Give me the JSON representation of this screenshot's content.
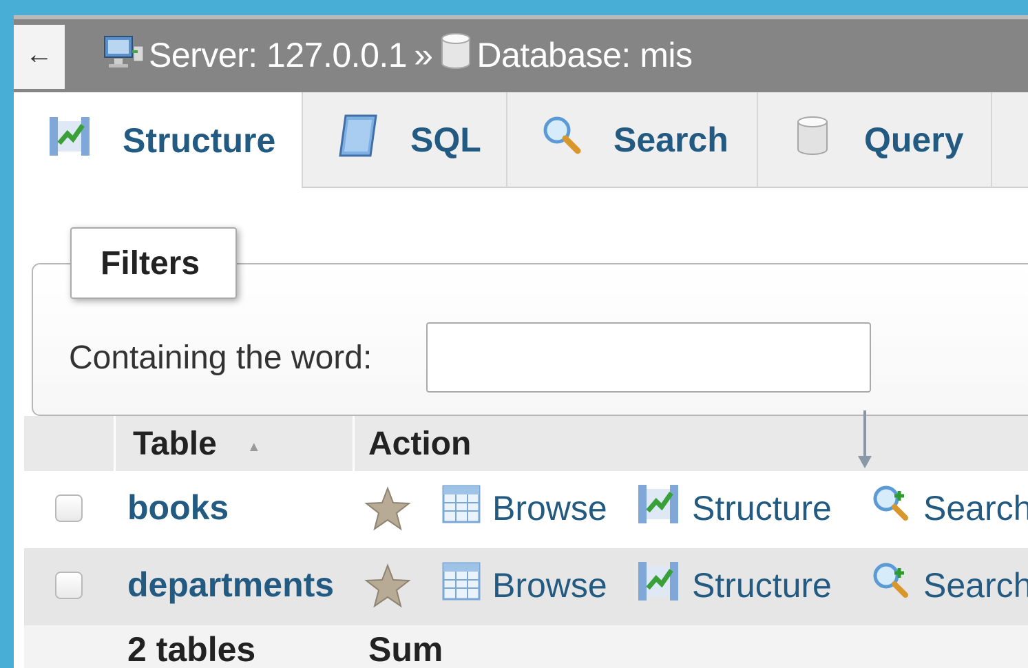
{
  "breadcrumb": {
    "back_label": "←",
    "server_label": "Server: 127.0.0.1",
    "separator": "»",
    "database_label": "Database: mis"
  },
  "tabs": [
    {
      "label": "Structure",
      "icon": "structure-icon",
      "active": true
    },
    {
      "label": "SQL",
      "icon": "sql-icon",
      "active": false
    },
    {
      "label": "Search",
      "icon": "search-icon",
      "active": false
    },
    {
      "label": "Query",
      "icon": "query-icon",
      "active": false
    }
  ],
  "filters": {
    "legend": "Filters",
    "label": "Containing the word:",
    "value": ""
  },
  "table": {
    "headers": {
      "table": "Table",
      "action": "Action"
    },
    "rows": [
      {
        "name": "books",
        "actions": [
          "Browse",
          "Structure",
          "Search"
        ]
      },
      {
        "name": "departments",
        "actions": [
          "Browse",
          "Structure",
          "Search"
        ]
      }
    ],
    "footer": {
      "count": "2 tables",
      "sum": "Sum"
    }
  },
  "colors": {
    "background": "#49aed5",
    "topbar": "#858585",
    "link": "#235a81"
  }
}
